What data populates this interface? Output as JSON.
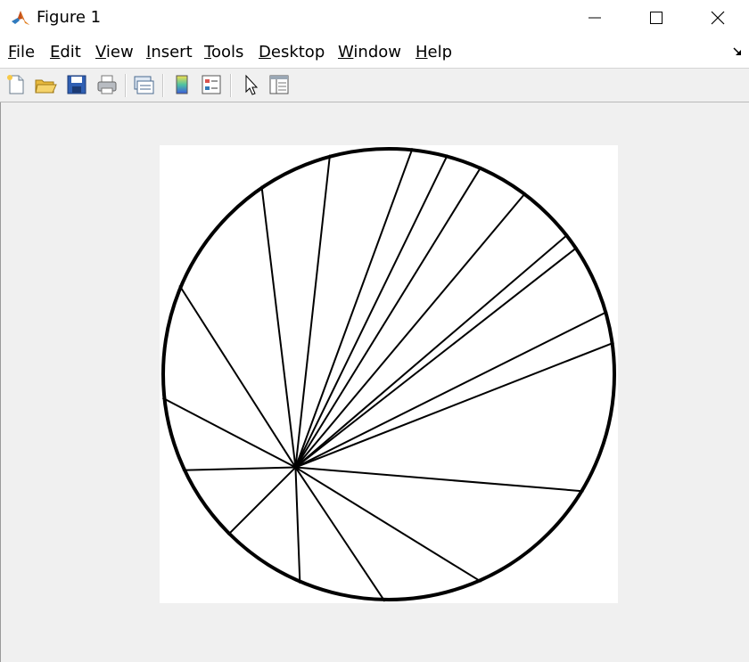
{
  "window": {
    "title": "Figure 1",
    "icon": "matlab-icon"
  },
  "title_buttons": [
    "minimize-icon",
    "maximize-icon",
    "close-icon"
  ],
  "menu": {
    "items": [
      "File",
      "Edit",
      "View",
      "Insert",
      "Tools",
      "Desktop",
      "Window",
      "Help"
    ],
    "dock_arrow": "dock-arrow-icon"
  },
  "toolbar": {
    "buttons": [
      "new-figure-icon",
      "open-file-icon",
      "save-icon",
      "print-icon",
      "link-plot-icon",
      "colorbar-icon",
      "legend-icon",
      "edit-plot-icon",
      "property-inspector-icon"
    ]
  },
  "colors": {
    "window_bg": "#f0f0f0",
    "axes_bg": "#ffffff",
    "line": "#000000"
  },
  "chart_data": {
    "type": "line",
    "description_circle": {
      "center": [
        0,
        0
      ],
      "radius": 1
    },
    "focal_point": [
      -0.41,
      -0.41
    ],
    "chord_endpoint_angles_deg": [
      84,
      66,
      38,
      8,
      -31,
      -66,
      -91,
      -113,
      -135,
      -155,
      -174,
      -203,
      -236,
      -255,
      -285,
      -307,
      -326,
      -344
    ],
    "title": "",
    "xlabel": "",
    "ylabel": "",
    "axis_visible": false,
    "xlim": [
      -1,
      1
    ],
    "ylim": [
      -1,
      1
    ],
    "grid": false
  }
}
